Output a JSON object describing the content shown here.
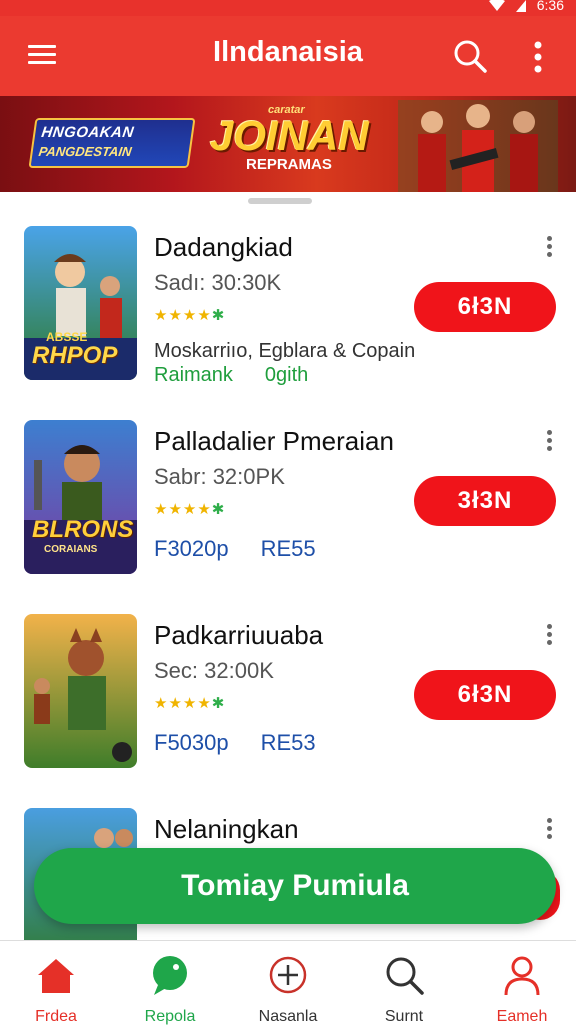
{
  "status": {
    "time": "6:36"
  },
  "appbar": {
    "title": "Ilndanaisia"
  },
  "banner": {
    "logo_line1": "HNGOAKAN",
    "logo_line2": "PANGDESTAIN",
    "headline_small": "caratar",
    "headline": "JOINAN",
    "headline_sub": "REPRAMAS"
  },
  "items": [
    {
      "title": "Dadangkiad",
      "subtitle": "Sadı: 30:30K",
      "stars": "★★★★",
      "star_last": "✱",
      "developer": "Moskarriıo, Egblara & Copain",
      "tag1": "Raimank",
      "tag2": "0gith",
      "button": "6ł3N",
      "thumb_caption": "RHPOP",
      "thumb_small": "ABSSE"
    },
    {
      "title": "Palladalier Pmeraian",
      "subtitle": "Sabr: 32:0PK",
      "stars": "★★★★",
      "star_last": "✱",
      "price": "F3020p",
      "region": "RE55",
      "button": "3ł3N",
      "thumb_caption": "BLRONS",
      "thumb_small": "CORAIANS"
    },
    {
      "title": "Padkarriuuaba",
      "subtitle": "Sec: 32:00K",
      "stars": "★★★★",
      "star_last": "✱",
      "price": "F5030p",
      "region": "RE53",
      "button": "6ł3N"
    },
    {
      "title": "Nelaningkan"
    }
  ],
  "cta": {
    "label": "Tomiay Pumiula"
  },
  "nav": [
    {
      "label": "Frdea",
      "icon": "home-icon",
      "color": "#e53028"
    },
    {
      "label": "Repola",
      "icon": "chat-bubble-icon",
      "color": "#1fa64a"
    },
    {
      "label": "Nasanla",
      "icon": "plus-circle-icon",
      "color": "#333333"
    },
    {
      "label": "Surnt",
      "icon": "search-icon",
      "color": "#333333"
    },
    {
      "label": "Eameh",
      "icon": "profile-icon",
      "color": "#e53028"
    }
  ],
  "colors": {
    "brand": "#eb3a30",
    "button": "#f0141a",
    "cta": "#1fa64a"
  }
}
